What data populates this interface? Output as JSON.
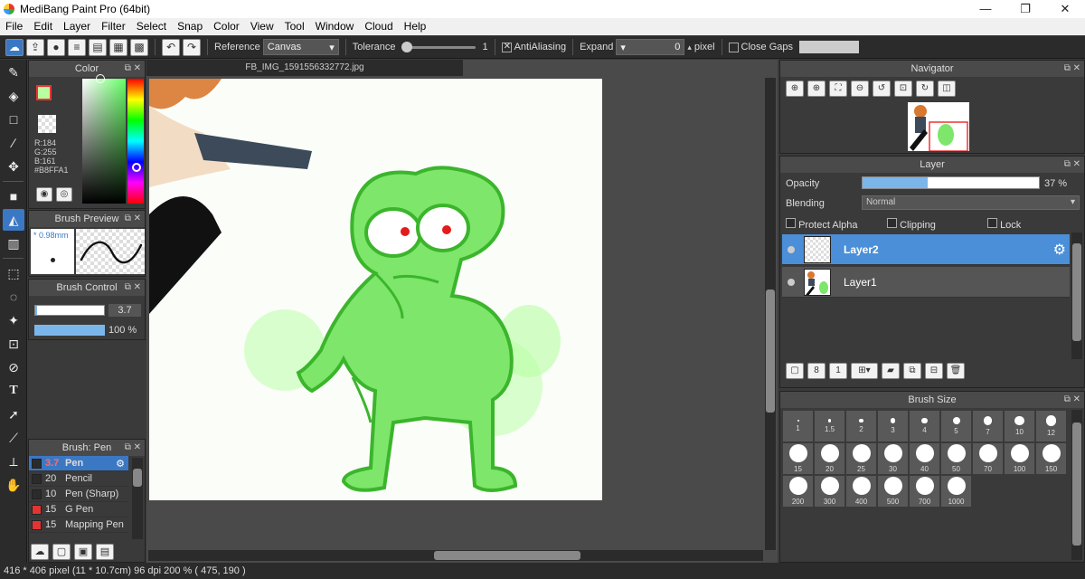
{
  "window": {
    "title": "MediBang Paint Pro (64bit)",
    "controls": [
      "—",
      "❐",
      "✕"
    ]
  },
  "menu": [
    "File",
    "Edit",
    "Layer",
    "Filter",
    "Select",
    "Snap",
    "Color",
    "View",
    "Tool",
    "Window",
    "Cloud",
    "Help"
  ],
  "toolbar": {
    "reference_label": "Reference",
    "reference_value": "Canvas",
    "tolerance_label": "Tolerance",
    "tolerance_value": "1",
    "antialiasing_label": "AntiAliasing",
    "antialiasing_checked": true,
    "expand_label": "Expand",
    "expand_value": "0",
    "pixel_label": "pixel",
    "close_gaps_label": "Close Gaps",
    "close_gaps_checked": false
  },
  "tools": [
    "brush-tool-icon",
    "eraser-tool-icon",
    "rect-tool-icon",
    "dot-tool-icon",
    "move-tool-icon",
    "fill-rect-tool-icon",
    "bucket-tool-icon",
    "gradient-tool-icon",
    "select-rect-tool-icon",
    "lasso-tool-icon",
    "magic-wand-tool-icon",
    "select-pen-tool-icon",
    "select-eraser-tool-icon",
    "text-tool-icon",
    "operation-tool-icon",
    "divide-tool-icon",
    "eyedropper-tool-icon",
    "hand-tool-icon"
  ],
  "color_panel": {
    "title": "Color",
    "r": "R:184",
    "g": "G:255",
    "b": "B:161",
    "hex": "#B8FFA1",
    "fg_color": "#B8FFA1"
  },
  "brush_preview": {
    "title": "Brush Preview",
    "size": "* 0.98mm"
  },
  "brush_control": {
    "title": "Brush Control",
    "size_value": "3.7",
    "opacity_value": "100 %",
    "size_fraction": 0.03,
    "opacity_fraction": 1.0
  },
  "brush_list": {
    "title": "Brush: Pen",
    "items": [
      {
        "size": "3.7",
        "name": "Pen",
        "color": "#2b2b2b",
        "active": true
      },
      {
        "size": "20",
        "name": "Pencil",
        "color": "#2b2b2b",
        "active": false
      },
      {
        "size": "10",
        "name": "Pen (Sharp)",
        "color": "#2b2b2b",
        "active": false
      },
      {
        "size": "15",
        "name": "G Pen",
        "color": "#e33333",
        "active": false
      },
      {
        "size": "15",
        "name": "Mapping Pen",
        "color": "#e33333",
        "active": false
      }
    ]
  },
  "canvas": {
    "tab": "FB_IMG_1591556332772.jpg"
  },
  "navigator": {
    "title": "Navigator"
  },
  "layer_panel": {
    "title": "Layer",
    "opacity_label": "Opacity",
    "opacity_value": "37 %",
    "opacity_fraction": 0.37,
    "blending_label": "Blending",
    "blending_value": "Normal",
    "protect_alpha_label": "Protect Alpha",
    "clipping_label": "Clipping",
    "lock_label": "Lock",
    "layers": [
      {
        "name": "Layer2",
        "active": true
      },
      {
        "name": "Layer1",
        "active": false
      }
    ]
  },
  "brush_size": {
    "title": "Brush Size",
    "sizes": [
      "1",
      "1.5",
      "2",
      "3",
      "4",
      "5",
      "7",
      "10",
      "12",
      "15",
      "20",
      "25",
      "30",
      "40",
      "50",
      "70",
      "100",
      "150",
      "200",
      "300",
      "400",
      "500",
      "700",
      "1000"
    ]
  },
  "status": {
    "text": "416 * 406 pixel  (11 * 10.7cm)  96 dpi  200 %  ( 475, 190 )"
  }
}
